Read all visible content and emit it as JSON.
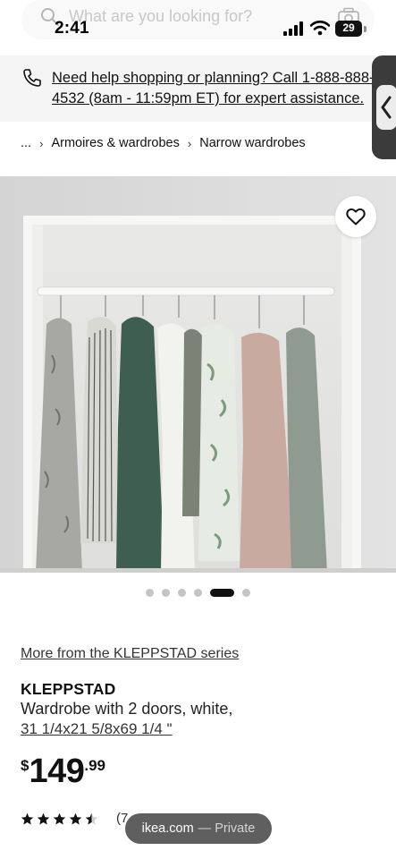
{
  "status_bar": {
    "time": "2:41",
    "battery": "29"
  },
  "search": {
    "placeholder": "What are you looking for?"
  },
  "help_banner": {
    "text": "Need help shopping or planning? Call 1-888-888-4532 (8am - 11:59pm ET) for expert assistance."
  },
  "breadcrumb": {
    "ellipsis": "...",
    "items": [
      "Armoires & wardrobes",
      "Narrow wardrobes"
    ],
    "separator": "›"
  },
  "carousel": {
    "total": 6,
    "active_index": 4
  },
  "product": {
    "series_link": "More from the KLEPPSTAD series",
    "name": "KLEPPSTAD",
    "description": "Wardrobe with 2 doors, white,",
    "dimensions": "31 1/4x21 5/8x69 1/4 \"",
    "price": {
      "currency": "$",
      "integer": "149",
      "decimal": ".99"
    },
    "rating": 4.5,
    "review_count_partial": "(7"
  },
  "browser": {
    "domain": "ikea.com",
    "mode": "— Private"
  },
  "colors": {
    "banner_bg": "#f5f5f5",
    "drawer_tab": "#3b3b3b",
    "url_pill": "#5f5f5f",
    "text": "#111111"
  },
  "icons": {
    "search": "search-icon",
    "camera": "camera-icon",
    "phone": "phone-icon",
    "heart": "heart-icon",
    "chevron": "chevron-left-icon",
    "star": "star-icon"
  }
}
